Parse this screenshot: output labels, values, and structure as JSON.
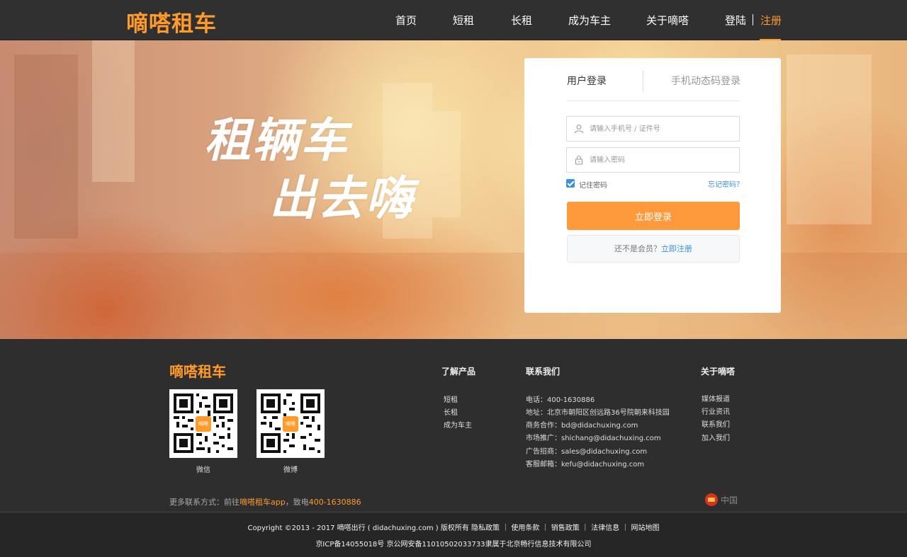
{
  "header": {
    "logo": "嘀嗒租车",
    "nav": [
      "首页",
      "短租",
      "长租",
      "成为车主",
      "关于嘀嗒"
    ],
    "login": "登陆",
    "register": "注册"
  },
  "hero": {
    "slogan_line1": "租辆车",
    "slogan_line2": "出去嗨"
  },
  "login_card": {
    "tab_user": "用户登录",
    "tab_phone": "手机动态码登录",
    "username_placeholder": "请输入手机号 / 证件号",
    "password_placeholder": "请输入密码",
    "remember": "记住密码",
    "remember_checked": true,
    "forgot": "忘记密码？",
    "submit": "立即登录",
    "not_member": "还不是会员？",
    "register_now": "立即注册"
  },
  "footer": {
    "logo": "嘀嗒租车",
    "qr_badge": "嘀嗒",
    "qr": [
      {
        "caption": "微信"
      },
      {
        "caption": "微博"
      }
    ],
    "products": {
      "title": "了解产品",
      "items": [
        "短租",
        "长租",
        "成为车主"
      ]
    },
    "contact": {
      "title": "联系我们",
      "items": [
        "电话：400-1630886",
        "地址：北京市朝阳区创远路36号院朝来科技园",
        "商务合作：bd@didachuxing.com",
        "市场推广：shichang@didachuxing.com",
        "广告招商：sales@didachuxing.com",
        "客服邮箱：kefu@didachuxing.com"
      ]
    },
    "about": {
      "title": "关于嘀嗒",
      "items": [
        "媒体报道",
        "行业资讯",
        "联系我们",
        "加入我们"
      ]
    },
    "more_prefix": "更多联系方式：前往",
    "more_app": "嘀嗒租车app",
    "more_mid": "，致电",
    "more_phone": "400-1630886",
    "region": "中国",
    "copyright": "Copyright ©2013 - 2017 嘀嗒出行 ( didachuxing.com ) 版权所有 隐私政策 ｜ 使用条款 ｜ 销售政策 ｜ 法律信息 ｜ 网站地图",
    "icp": "京ICP备14055018号 京公网安备11010502033733隶属于北京畅行信息技术有限公司"
  },
  "colors": {
    "brand": "#ff9a2b",
    "link": "#3b8fe6",
    "header_bg": "#303030",
    "footer_bg": "#2e2e2e"
  }
}
